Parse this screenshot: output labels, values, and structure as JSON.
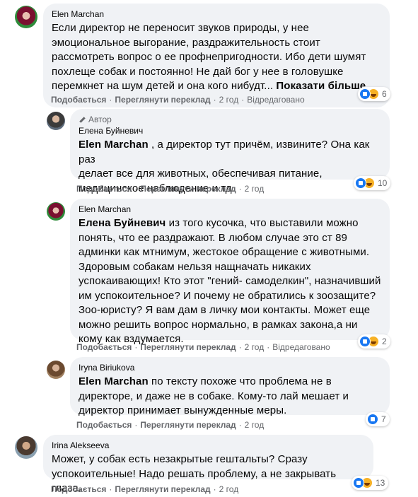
{
  "labels": {
    "like": "Подобається",
    "translate": "Переглянути переклад",
    "edited": "Відредаговано",
    "show_more": "Показати більше...",
    "author_badge": "Автор",
    "dot": "·"
  },
  "comments": [
    {
      "author": "Elen Marchan",
      "lines": [
        "Если директор не переносит звуков природы, у нее",
        "эмоциональное выгорание, раздражительность стоит",
        "рассмотреть вопрос о ее профнепригодности. Ибо дети шумят",
        "похлеще собак и постоянно! Не дай бог у нее в головушке",
        "перемкнет на шум детей и она кого нибудт..."
      ],
      "time": "2 год",
      "reactions": "6"
    },
    {
      "author": "Елена Буйневич",
      "mention": "Elen Marchan",
      "lines": [
        ", а директор тут причём, извините? Она как раз",
        "делает все для животных, обеспечивая питание,",
        "медицинское наблюдение и тд."
      ],
      "time": "2 год",
      "reactions": "10"
    },
    {
      "author": "Elen Marchan",
      "mention": "Елена Буйневич",
      "lines": [
        "из того кусочка, что выставили можно",
        "понять, что ее раздражают. В любом случае это ст 89",
        "админки как мтнимум, жестокое обращение с животными.",
        "Здоровым собакам нельзя нащначать никаких",
        "успокаивающих! Кто этот \"гений- самоделкин\", назначивший",
        "им успокоительное? И почему не обратились к зоозащите?",
        "Зоо-юристу? Я вам дам в личку мои контакты. Может еще",
        "можно решить вопрос нормально, в рамках закона,а ни",
        "кому как вздумается."
      ],
      "time": "2 год",
      "reactions": "2"
    },
    {
      "author": "Iryna Biriukova",
      "mention": "Elen Marchan",
      "lines": [
        "по тексту похоже что проблема не в",
        "директоре, и даже не в собаке. Кому-то лай мешает и",
        "директор принимает вынужденные меры."
      ],
      "time": "2 год",
      "reactions": "7"
    },
    {
      "author": "Irina Alekseeva",
      "lines": [
        "Может, у собак есть незакрытые гештальты? Сразу",
        "успокоительные! Надо решать проблему, а не закрывать глаза."
      ],
      "time": "2 год",
      "reactions": "13"
    }
  ],
  "colors": {
    "bubble": "#f0f2f5",
    "meta": "#65676b",
    "like": "#1877f2",
    "haha": "#f7b125"
  }
}
